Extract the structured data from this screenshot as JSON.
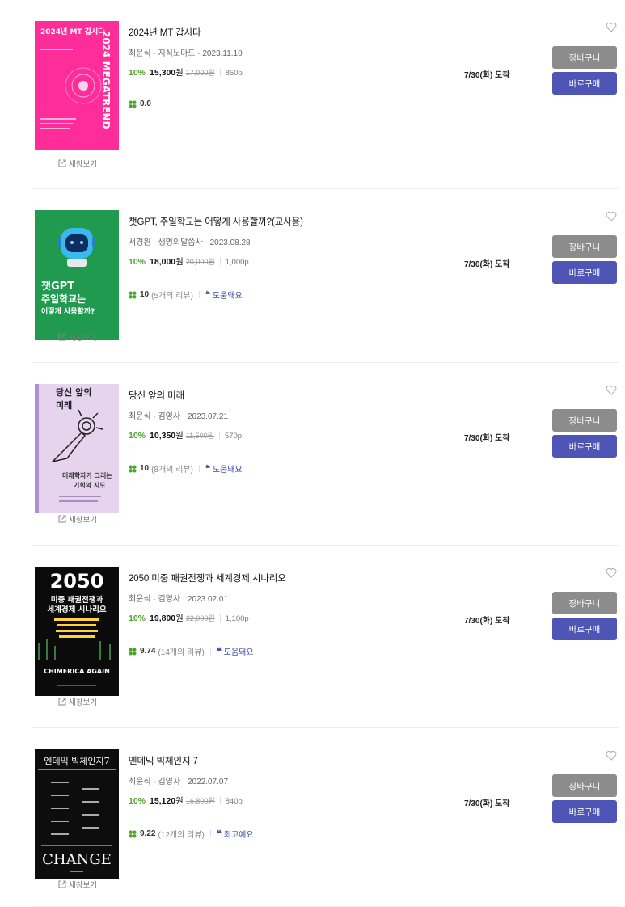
{
  "labels": {
    "cart": "장바구니",
    "buy": "바로구매",
    "new_window": "새창보기"
  },
  "items": [
    {
      "title": "2024년 MT 갑시다",
      "meta": "최윤식 · 지식노마드 · 2023.11.10",
      "discount": "10%",
      "price": "15,300",
      "won": "원",
      "original_price": "17,000원",
      "pages": "850p",
      "score": "0.0",
      "reviews": "",
      "helpful": "",
      "delivery": "7/30(화) 도착",
      "cover": {
        "bg": "#ff2d9a",
        "text": "2024년 MT 갑시다",
        "spine": "2024 MEGATREND"
      }
    },
    {
      "title": "챗GPT, 주일학교는 어떻게 사용할까?(교사용)",
      "meta": "서경원 · 생명의말씀사 · 2023.08.28",
      "discount": "10%",
      "price": "18,000",
      "won": "원",
      "original_price": "20,000원",
      "pages": "1,000p",
      "score": "10",
      "reviews": "(5개의 리뷰)",
      "helpful": "도움돼요",
      "delivery": "7/30(화) 도착",
      "cover": {
        "bg": "#1f9a4e",
        "line1": "챗GPT",
        "line2": "주일학교는",
        "line3": "어떻게 사용할까?"
      }
    },
    {
      "title": "당신 앞의 미래",
      "meta": "최윤식 · 김영사 · 2023.07.21",
      "discount": "10%",
      "price": "10,350",
      "won": "원",
      "original_price": "11,500원",
      "pages": "570p",
      "score": "10",
      "reviews": "(8개의 리뷰)",
      "helpful": "도움돼요",
      "delivery": "7/30(화) 도착",
      "cover": {
        "bg": "#e6d4ef",
        "line1": "당신 앞의",
        "line2": "미래",
        "sub1": "미래학자가 그리는",
        "sub2": "기회의 지도"
      }
    },
    {
      "title": "2050 미중 패권전쟁과 세계경제 시나리오",
      "meta": "최윤식 · 김영사 · 2023.02.01",
      "discount": "10%",
      "price": "19,800",
      "won": "원",
      "original_price": "22,000원",
      "pages": "1,100p",
      "score": "9.74",
      "reviews": "(14개의 리뷰)",
      "helpful": "도움돼요",
      "delivery": "7/30(화) 도착",
      "cover": {
        "bg": "#0b0b0b",
        "year": "2050",
        "line1": "미중 패권전쟁과",
        "line2": "세계경제 시나리오",
        "footer": "CHIMERICA AGAIN"
      }
    },
    {
      "title": "엔데믹 빅체인지 7",
      "meta": "최윤식 · 김영사 · 2022.07.07",
      "discount": "10%",
      "price": "15,120",
      "won": "원",
      "original_price": "16,800원",
      "pages": "840p",
      "score": "9.22",
      "reviews": "(12개의 리뷰)",
      "helpful": "최고예요",
      "delivery": "7/30(화) 도착",
      "cover": {
        "bg": "#0d0d0d",
        "line1": "엔데믹 빅체인지7",
        "footer": "CHANGE"
      }
    }
  ],
  "colors": {
    "discount": "#4ea32b",
    "cart_button": "#8c8c8c",
    "buy_button": "#4e55b5",
    "helpful_text": "#3f4aa0"
  }
}
